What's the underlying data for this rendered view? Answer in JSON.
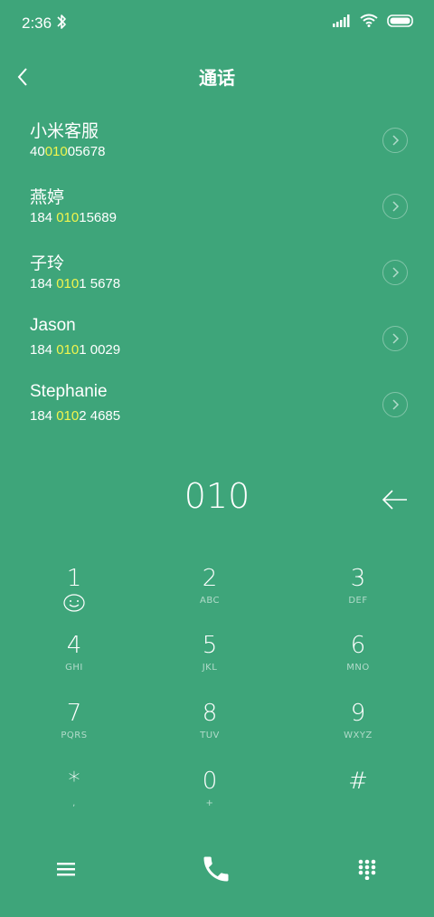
{
  "status": {
    "time": "2:36"
  },
  "header": {
    "title": "通话"
  },
  "contacts": [
    {
      "name": "小米客服",
      "num_pre": "40",
      "num_hl": "010",
      "num_post": "05678"
    },
    {
      "name": "燕婷",
      "num_pre": "184 ",
      "num_hl": "010",
      "num_post": "15689"
    },
    {
      "name": "子玲",
      "num_pre": "184 ",
      "num_hl": "010",
      "num_post": "1 5678"
    },
    {
      "name": "Jason",
      "num_pre": "184 ",
      "num_hl": "010",
      "num_post": "1 0029"
    },
    {
      "name": "Stephanie",
      "num_pre": "184 ",
      "num_hl": "010",
      "num_post": "2 4685"
    }
  ],
  "dial": {
    "input": "010"
  },
  "keypad": [
    {
      "digit": "1",
      "sub": ""
    },
    {
      "digit": "2",
      "sub": "ABC"
    },
    {
      "digit": "3",
      "sub": "DEF"
    },
    {
      "digit": "4",
      "sub": "GHI"
    },
    {
      "digit": "5",
      "sub": "JKL"
    },
    {
      "digit": "6",
      "sub": "MNO"
    },
    {
      "digit": "7",
      "sub": "PQRS"
    },
    {
      "digit": "8",
      "sub": "TUV"
    },
    {
      "digit": "9",
      "sub": "WXYZ"
    },
    {
      "digit": "*",
      "sub": ","
    },
    {
      "digit": "0",
      "sub": "+"
    },
    {
      "digit": "#",
      "sub": ""
    }
  ],
  "colors": {
    "background": "#3ea57a",
    "highlight": "#f1f54d",
    "text": "#ffffff"
  },
  "icons": {
    "status": [
      "bluetooth-icon",
      "signal-icon",
      "wifi-icon",
      "battery-icon"
    ],
    "header": "back-arrow-icon",
    "row": "chevron-right-icon",
    "backspace": "backspace-arrow-icon",
    "key1": "smiley-voicemail-icon",
    "bottom": [
      "menu-icon",
      "phone-call-icon",
      "dialpad-icon"
    ]
  }
}
